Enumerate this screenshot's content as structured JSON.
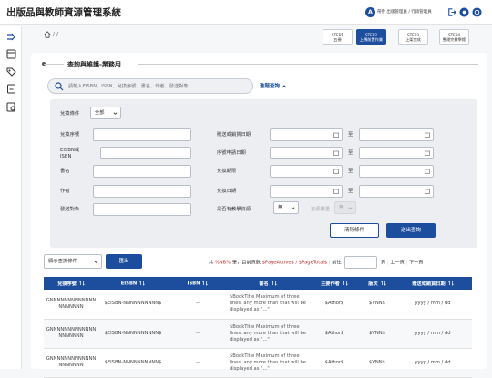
{
  "app": {
    "title": "出版品與教師資源管理系統"
  },
  "user": {
    "avatar": "A",
    "name": "帶參 出版管理員 / 行銷管理員"
  },
  "breadcrumb": {
    "separator": "/"
  },
  "steps": [
    {
      "label": "STEP1",
      "desc": "五冊",
      "active": false
    },
    {
      "label": "STEP2",
      "desc": "上傳前置作業",
      "active": true
    },
    {
      "label": "STEP3",
      "desc": "上架完成",
      "active": false
    },
    {
      "label": "STEP4",
      "desc": "整理完教學館",
      "active": false
    }
  ],
  "section": {
    "title": "查詢與維護-業務用"
  },
  "search": {
    "placeholder": "請輸入EISBN、ISBN、兌換序號、書名、作者、發送對象",
    "value": ""
  },
  "advanced": {
    "toggle_label": "進階查詢",
    "condition_label": "兌換條件",
    "condition_value": "全部",
    "fields_left": [
      "兌換序號",
      "EISBN或ISBN",
      "書名",
      "作者",
      "發送對象"
    ],
    "fields_right": [
      "贈送或銷貨日期",
      "序號申請日期",
      "兌換期限",
      "兌換日期",
      "是否有教學資源"
    ],
    "to_label": "至",
    "resource_value": "無",
    "resource2_label": "資源數量",
    "resource2_value": "無",
    "clear_label": "清除條件",
    "submit_label": "送出查詢"
  },
  "toolbar": {
    "display_label": "顯示查詢條件",
    "export_label": "匯出"
  },
  "pagination": {
    "prefix": "共",
    "count": "%NB%",
    "mid": "筆，目前頁數",
    "active": "$PageActive$",
    "slash": "/",
    "total": "$PageTotal$",
    "goto_label": "前往",
    "page_label": "頁",
    "prev_label": "上一頁",
    "next_label": "下一頁"
  },
  "table": {
    "columns": [
      "兌換序號",
      "EISBN",
      "ISBN",
      "書名",
      "主要作者",
      "版次",
      "贈送或銷貨日期"
    ],
    "rows": [
      {
        "serial": "GNNNNNNNNNNNNNNNNNNNN",
        "eisbn": "$EISBN-NNNNNNNNNN$",
        "isbn": "--",
        "title": "$BookTitle Maximum of three lines, any more than that will be displayed as \"...\"",
        "author": "$Athor$",
        "edition": "$VNN$",
        "date": "yyyy / mm / dd"
      },
      {
        "serial": "GNNNNNNNNNNNNNNNNNNNN",
        "eisbn": "$EISBN-NNNNNNNNNN$",
        "isbn": "--",
        "title": "$BookTitle Maximum of three lines, any more than that will be displayed as \"...\"",
        "author": "$Athor$",
        "edition": "$VNN$",
        "date": "yyyy / mm / dd"
      },
      {
        "serial": "GNNNNNNNNNNNNNNNNNNNN",
        "eisbn": "$EISBN-NNNNNNNNNN$",
        "isbn": "--",
        "title": "$BookTitle Maximum of three lines, any more than that will be displayed as \"...\"",
        "author": "$Athor$",
        "edition": "$VNN$",
        "date": "yyyy / mm / dd"
      }
    ]
  },
  "colors": {
    "primary": "#1d4e9e",
    "accent_red": "#d0302b"
  },
  "icons": [
    "logout-icon",
    "settings-icon",
    "theme-icon",
    "home-icon",
    "search-icon",
    "calendar-icon",
    "chevron-down-icon",
    "sort-icon"
  ]
}
